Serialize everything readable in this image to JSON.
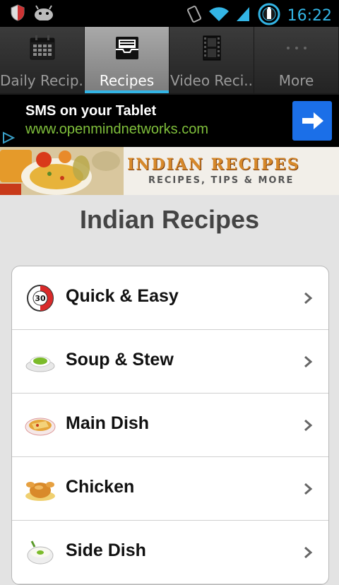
{
  "status_bar": {
    "time": "16:22",
    "left_icons": [
      "shield-icon",
      "android-icon"
    ],
    "right_icons": [
      "vibrate-icon",
      "wifi-icon",
      "signal-icon",
      "battery-charging-icon"
    ]
  },
  "tabs": [
    {
      "label": "Daily Recip..",
      "icon": "calendar-icon",
      "active": false
    },
    {
      "label": "Recipes",
      "icon": "inbox-icon",
      "active": true
    },
    {
      "label": "Video Reci..",
      "icon": "film-icon",
      "active": false
    },
    {
      "label": "More",
      "icon": "more-dots-icon",
      "active": false
    }
  ],
  "ad": {
    "title": "SMS on your Tablet",
    "url": "www.openmindnetworks.com"
  },
  "banner": {
    "title": "INDIAN RECIPES",
    "subtitle": "RECIPES, TIPS & MORE"
  },
  "page_title": "Indian Recipes",
  "categories": [
    {
      "label": "Quick & Easy",
      "icon": "timer-30-icon"
    },
    {
      "label": "Soup & Stew",
      "icon": "soup-bowl-icon"
    },
    {
      "label": "Main Dish",
      "icon": "main-dish-plate-icon"
    },
    {
      "label": "Chicken",
      "icon": "roast-chicken-icon"
    },
    {
      "label": "Side Dish",
      "icon": "side-dish-bowl-icon"
    }
  ],
  "colors": {
    "accent": "#33b5e5",
    "ad_url": "#7fbf3b",
    "ad_button": "#1b6fe8",
    "banner_title": "#d7892a"
  }
}
